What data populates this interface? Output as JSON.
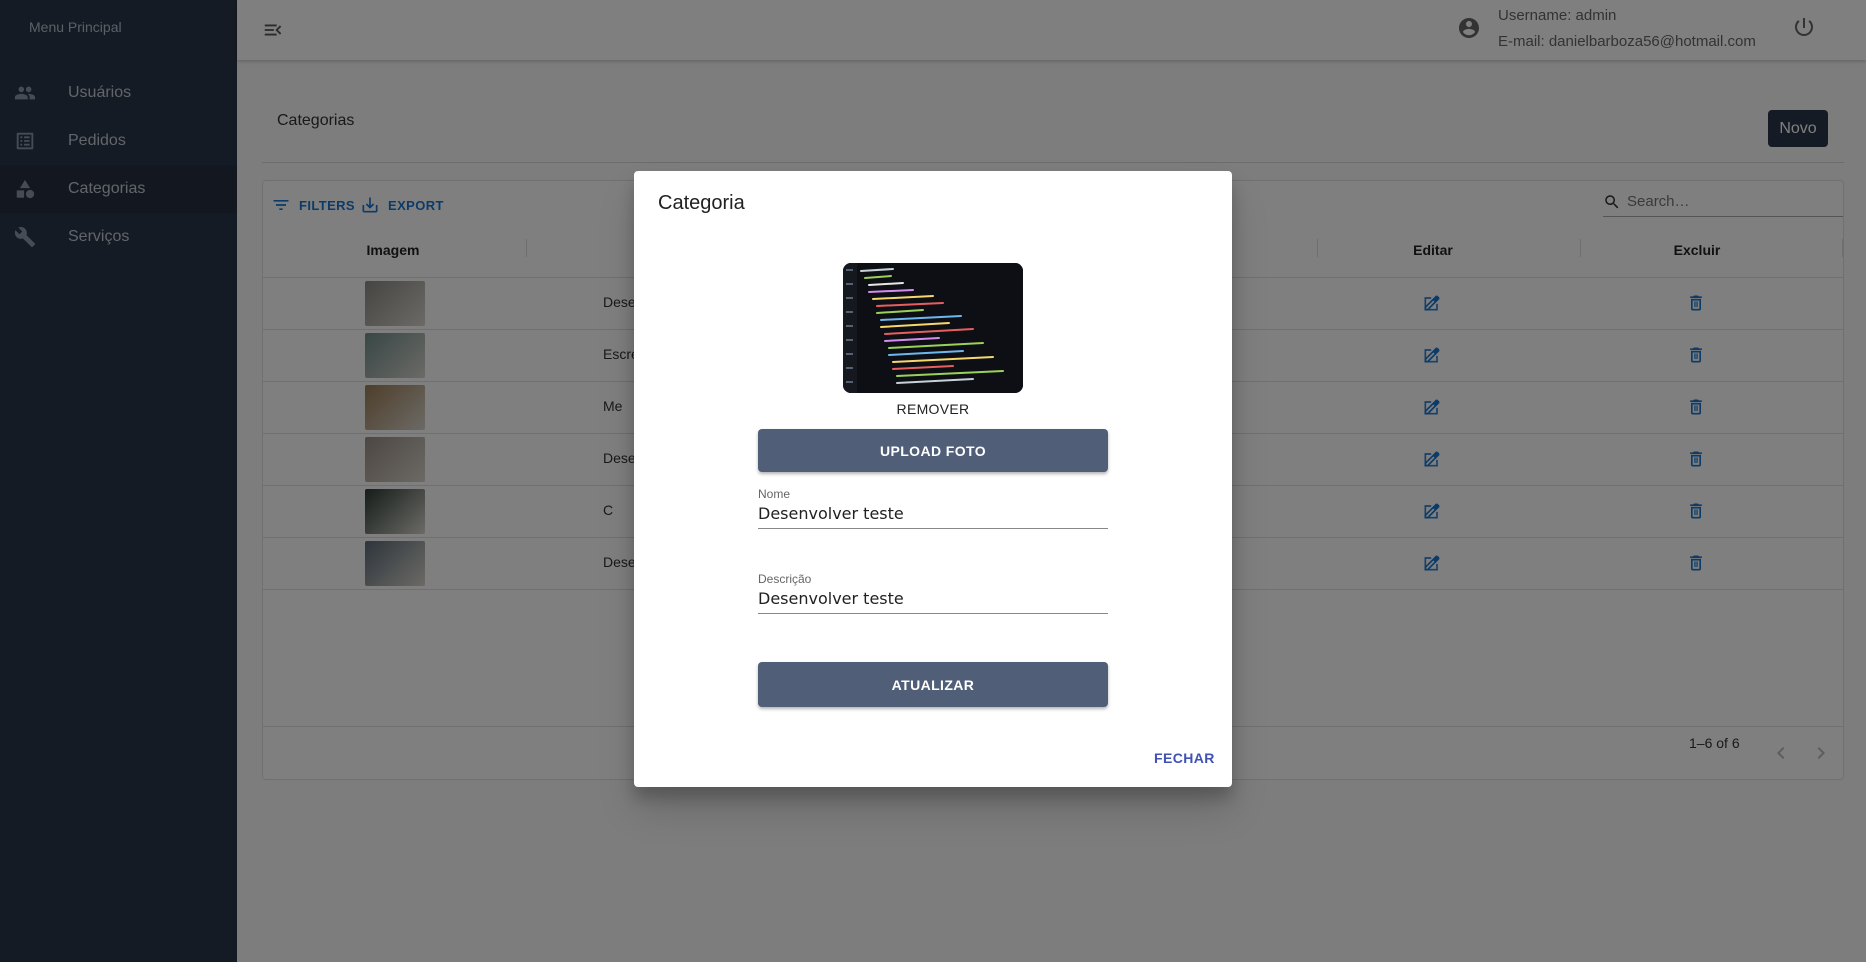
{
  "sidebar": {
    "title": "Menu Principal",
    "items": [
      {
        "label": "Usuários",
        "icon": "people-icon"
      },
      {
        "label": "Pedidos",
        "icon": "list-icon"
      },
      {
        "label": "Categorias",
        "icon": "category-icon"
      },
      {
        "label": "Serviços",
        "icon": "tools-icon"
      }
    ],
    "active_index": 2
  },
  "topbar": {
    "username": "Username: admin",
    "email": "E-mail: danielbarboza56@hotmail.com"
  },
  "page": {
    "title": "Categorias",
    "new_button": "Novo"
  },
  "grid": {
    "filters_label": "FILTERS",
    "export_label": "EXPORT",
    "search_placeholder": "Search…",
    "columns": {
      "image": "Imagem",
      "edit": "Editar",
      "delete": "Excluir"
    },
    "rows": [
      {
        "name": "Dese",
        "thumb_color": "#8a8a86"
      },
      {
        "name": "Escre",
        "thumb_color": "#6f8f8c"
      },
      {
        "name": "Me",
        "thumb_color": "#9c7d55"
      },
      {
        "name": "Desen",
        "thumb_color": "#9a8e84"
      },
      {
        "name": "C",
        "thumb_color": "#2a3a34"
      },
      {
        "name": "Desen",
        "thumb_color": "#5c6a78"
      }
    ],
    "pagination": "1–6 of 6"
  },
  "dialog": {
    "title": "Categoria",
    "remove_label": "REMOVER",
    "upload_label": "UPLOAD FOTO",
    "name_label": "Nome",
    "name_value": "Desenvolver teste",
    "description_label": "Descrição",
    "description_value": "Desenvolver teste",
    "update_label": "ATUALIZAR",
    "close_label": "FECHAR"
  },
  "colors": {
    "sidebar_bg": "#2b3648",
    "accent": "#1976d2",
    "dialog_button": "#505e78",
    "close_link": "#3f51b5"
  }
}
